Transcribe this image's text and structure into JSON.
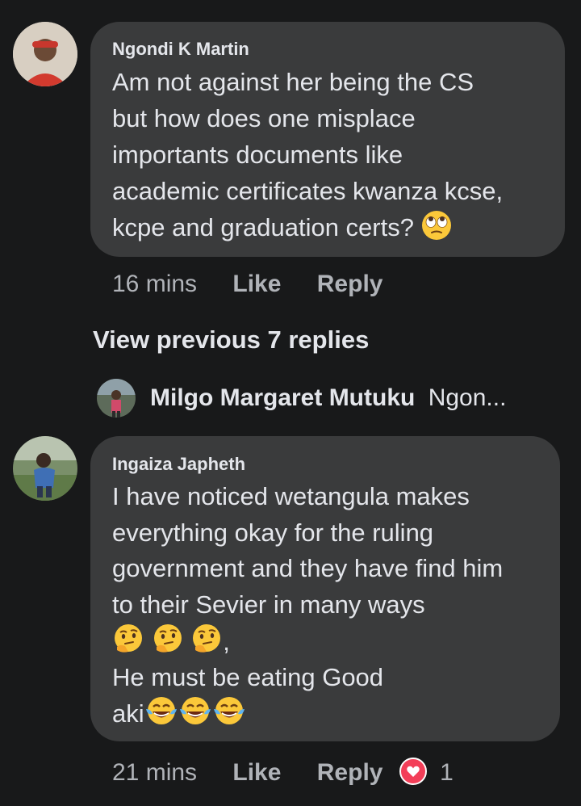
{
  "comments": [
    {
      "author": "Ngondi K Martin",
      "lines": [
        "Am not against her being the CS",
        "but how does one misplace",
        "importants documents like",
        "academic certificates kwanza kcse,",
        "kcpe and graduation certs?"
      ],
      "trailing_emoji": "face-with-rolling-eyes-emoji",
      "time": "16 mins",
      "like_label": "Like",
      "reply_label": "Reply"
    },
    {
      "author": "Ingaiza Japheth",
      "lines": [
        "I have noticed wetangula makes",
        "everything okay for the ruling",
        "government and they have find him",
        "to their Sevier in many ways",
        ",",
        "He must be eating Good",
        "aki"
      ],
      "time": "21 mins",
      "like_label": "Like",
      "reply_label": "Reply",
      "reaction_count": "1"
    }
  ],
  "view_previous": "View previous 7 replies",
  "reply_preview": {
    "name": "Milgo Margaret Mutuku",
    "snippet": "Ngon..."
  },
  "colors": {
    "background": "#18191a",
    "bubble": "#3a3b3c",
    "text": "#e4e6eb",
    "meta": "#b0b3b8",
    "reaction": "#f33e58"
  }
}
